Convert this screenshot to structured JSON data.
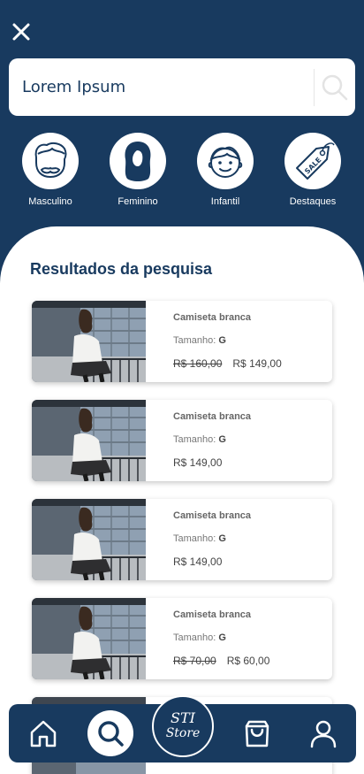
{
  "search": {
    "value": "Lorem Ipsum"
  },
  "categories": [
    {
      "label": "Masculino",
      "icon": "man-face-icon"
    },
    {
      "label": "Feminino",
      "icon": "woman-silhouette-icon"
    },
    {
      "label": "Infantil",
      "icon": "child-face-icon"
    },
    {
      "label": "Destaques",
      "icon": "sale-tag-icon",
      "tag_text": "SALE"
    }
  ],
  "results": {
    "title": "Resultados da pesquisa",
    "size_label": "Tamanho:",
    "items": [
      {
        "name": "Camiseta branca",
        "size": "G",
        "old_price": "R$ 160,00",
        "price": "R$ 149,00"
      },
      {
        "name": "Camiseta branca",
        "size": "G",
        "old_price": "",
        "price": "R$ 149,00"
      },
      {
        "name": "Camiseta branca",
        "size": "G",
        "old_price": "",
        "price": "R$ 149,00"
      },
      {
        "name": "Camiseta branca",
        "size": "G",
        "old_price": "R$ 70,00",
        "price": "R$ 60,00"
      }
    ]
  },
  "nav": {
    "logo_top": "STI",
    "logo_bottom": "Store"
  },
  "colors": {
    "primary": "#183a5f",
    "background": "#ffffff"
  }
}
